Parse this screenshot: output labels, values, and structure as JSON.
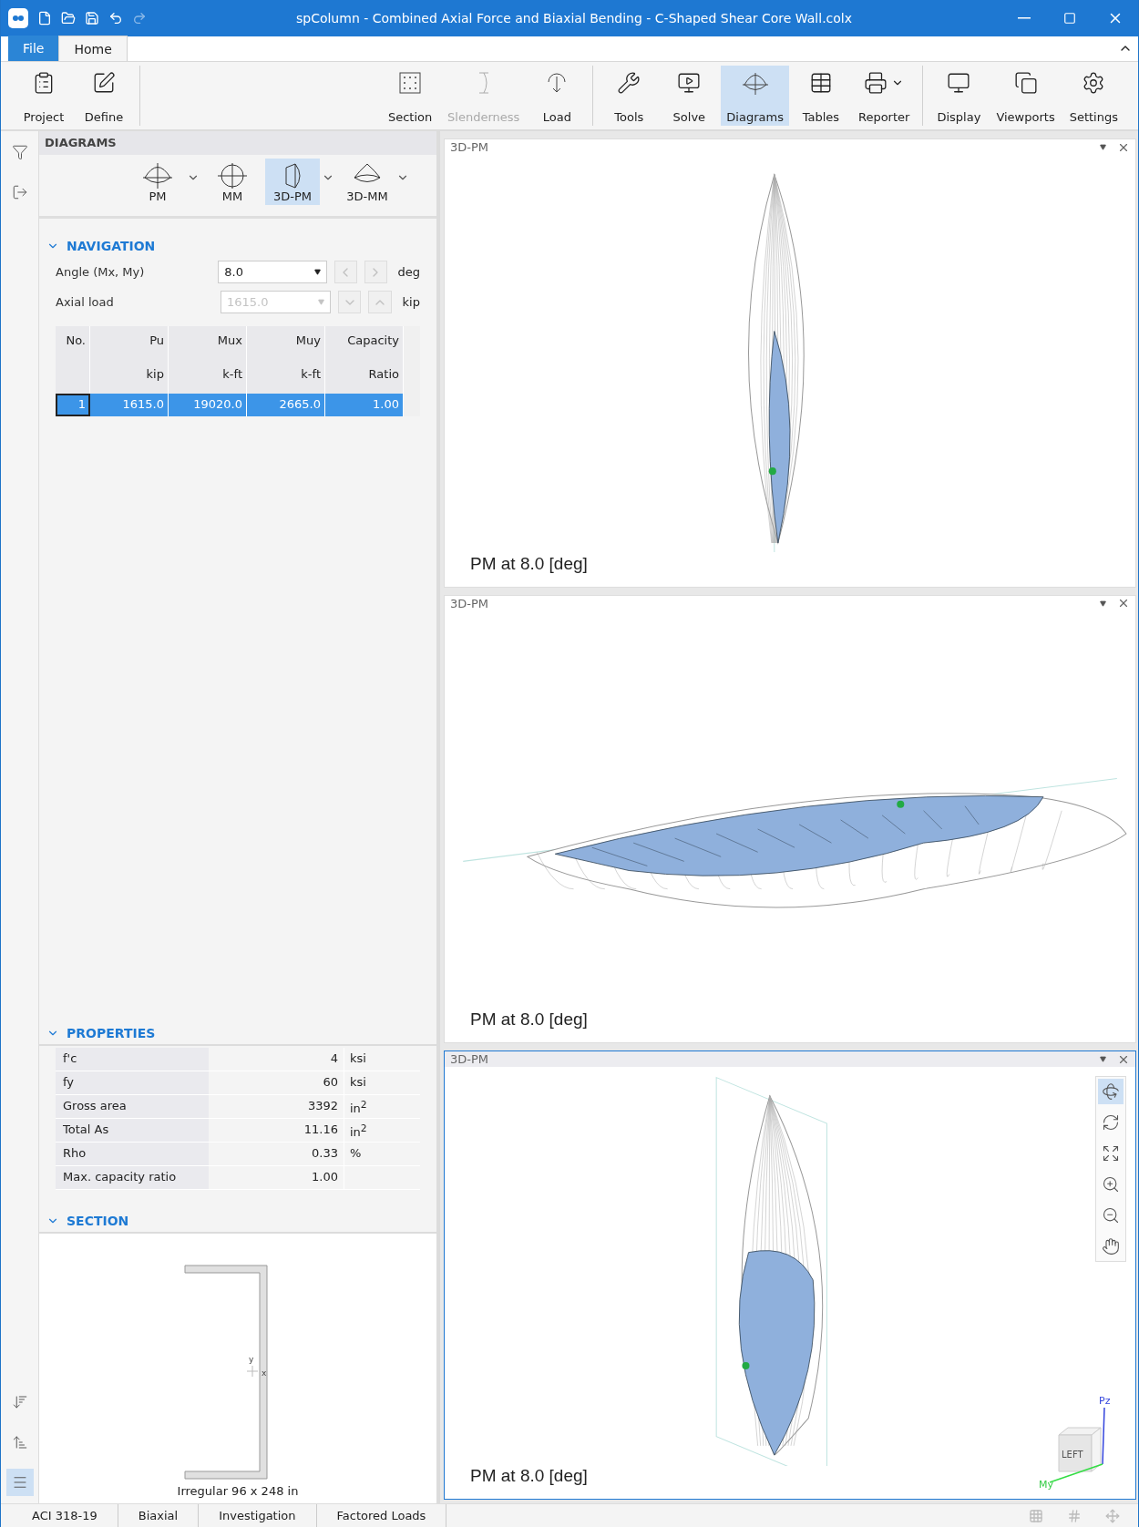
{
  "window": {
    "title": "spColumn - Combined Axial Force and Biaxial Bending - C-Shaped Shear Core Wall.colx"
  },
  "ribbon_tabs": [
    {
      "label": "File",
      "kind": "file",
      "selected": false
    },
    {
      "label": "Home",
      "kind": "tab",
      "selected": true
    }
  ],
  "ribbon": [
    [
      {
        "label": "Project",
        "kind": "project",
        "disabled": false,
        "selected": false,
        "dropdown": false
      },
      {
        "label": "Define",
        "kind": "define",
        "disabled": false,
        "selected": false,
        "dropdown": false
      }
    ],
    [
      {
        "label": "Section",
        "kind": "section",
        "disabled": false,
        "selected": false,
        "dropdown": false
      },
      {
        "label": "Slenderness",
        "kind": "slenderness",
        "disabled": true,
        "selected": false,
        "dropdown": false
      },
      {
        "label": "Load",
        "kind": "load",
        "disabled": false,
        "selected": false,
        "dropdown": false
      }
    ],
    [
      {
        "label": "Tools",
        "kind": "tools",
        "disabled": false,
        "selected": false,
        "dropdown": false
      },
      {
        "label": "Solve",
        "kind": "solve",
        "disabled": false,
        "selected": false,
        "dropdown": false
      },
      {
        "label": "Diagrams",
        "kind": "diagrams",
        "disabled": false,
        "selected": true,
        "dropdown": false
      },
      {
        "label": "Tables",
        "kind": "tables",
        "disabled": false,
        "selected": false,
        "dropdown": false
      },
      {
        "label": "Reporter",
        "kind": "reporter",
        "disabled": false,
        "selected": false,
        "dropdown": true
      }
    ],
    [
      {
        "label": "Display",
        "kind": "display",
        "disabled": false,
        "selected": false,
        "dropdown": false
      },
      {
        "label": "Viewports",
        "kind": "viewports",
        "disabled": false,
        "selected": false,
        "dropdown": false
      },
      {
        "label": "Settings",
        "kind": "settings",
        "disabled": false,
        "selected": false,
        "dropdown": false
      }
    ]
  ],
  "side_panel": {
    "title": "DIAGRAMS",
    "diagram_types": [
      {
        "label": "PM",
        "kind": "pm",
        "selected": false,
        "dropdown": true
      },
      {
        "label": "MM",
        "kind": "mm",
        "selected": false,
        "dropdown": false
      },
      {
        "label": "3D-PM",
        "kind": "pm3d",
        "selected": true,
        "dropdown": true
      },
      {
        "label": "3D-MM",
        "kind": "mm3d",
        "selected": false,
        "dropdown": true
      }
    ],
    "navigation": {
      "title": "NAVIGATION",
      "expanded": true,
      "fields": [
        {
          "label": "Angle (Mx, My)",
          "value": "8.0",
          "unit": "deg",
          "kind": "horizontal",
          "disabled": false
        },
        {
          "label": "Axial load",
          "value": "1615.0",
          "unit": "kip",
          "kind": "vertical",
          "disabled": true
        }
      ],
      "table": {
        "columns": [
          {
            "title": "No."
          },
          {
            "title": "Pu",
            "unit": "kip"
          },
          {
            "title": "Mux",
            "unit": "k-ft"
          },
          {
            "title": "Muy",
            "unit": "k-ft"
          },
          {
            "title": "Capacity",
            "unit": "Ratio"
          }
        ],
        "rows": [
          {
            "selected": true,
            "cells": [
              "1",
              "1615.0",
              "19020.0",
              "2665.0",
              "1.00"
            ]
          }
        ]
      }
    },
    "properties": {
      "title": "PROPERTIES",
      "expanded": true,
      "rows": [
        {
          "name": "f'c",
          "value": "4",
          "unit": "ksi"
        },
        {
          "name": "fy",
          "value": "60",
          "unit": "ksi"
        },
        {
          "name": "Gross area",
          "value": "3392",
          "unit": "in$^{2}$"
        },
        {
          "name": "Total As",
          "value": "11.16",
          "unit": "in$^{2}$"
        },
        {
          "name": "Rho",
          "value": "0.33",
          "unit": "%"
        },
        {
          "name": "Max. capacity ratio",
          "value": "1.00"
        }
      ]
    },
    "section": {
      "title": "SECTION",
      "expanded": true,
      "axis_labels": [
        "y",
        "x"
      ],
      "caption": "Irregular 96 x 248 in"
    }
  },
  "viewports": [
    {
      "title": "3D-PM",
      "caption": "PM at 8.0 [deg]",
      "active": false
    },
    {
      "title": "3D-PM",
      "caption": "PM at 8.0 [deg]",
      "active": false
    },
    {
      "title": "3D-PM",
      "caption": "PM at 8.0 [deg]",
      "active": true,
      "view_tools": [
        {
          "kind": "orbit",
          "selected": true
        },
        {
          "kind": "rotate",
          "selected": false
        },
        {
          "kind": "fit",
          "selected": false
        },
        {
          "kind": "zoom_in",
          "selected": false
        },
        {
          "kind": "zoom_out",
          "selected": false
        },
        {
          "kind": "pan",
          "selected": false
        }
      ],
      "nav_cube": {
        "face": "LEFT",
        "axes": [
          "Pz",
          "My"
        ]
      }
    }
  ],
  "status_bar": [
    "ACI 318-19",
    "Biaxial",
    "Investigation",
    "Factored Loads"
  ]
}
